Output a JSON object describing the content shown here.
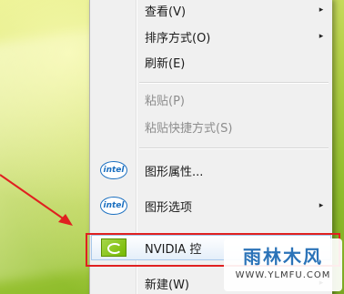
{
  "context_menu": {
    "items": [
      {
        "label": "查看(V)",
        "has_submenu": true,
        "enabled": true
      },
      {
        "label": "排序方式(O)",
        "has_submenu": true,
        "enabled": true
      },
      {
        "label": "刷新(E)",
        "has_submenu": false,
        "enabled": true
      },
      {
        "label": "粘贴(P)",
        "has_submenu": false,
        "enabled": false
      },
      {
        "label": "粘贴快捷方式(S)",
        "has_submenu": false,
        "enabled": false
      },
      {
        "label": "图形属性...",
        "has_submenu": false,
        "enabled": true,
        "icon": "intel-icon",
        "icon_text": "intel"
      },
      {
        "label": "图形选项",
        "has_submenu": true,
        "enabled": true,
        "icon": "intel-icon",
        "icon_text": "intel"
      },
      {
        "label": "NVIDIA 控",
        "has_submenu": false,
        "enabled": true,
        "icon": "nvidia-icon",
        "highlighted": true
      },
      {
        "label": "新建(W)",
        "has_submenu": true,
        "enabled": true
      }
    ],
    "submenu_glyph": "▸"
  },
  "watermark": {
    "title": "雨林木风",
    "url": "WWW.YLMFU.COM"
  },
  "colors": {
    "annotation_red": "#e02020",
    "menu_background": "#f0f0f0",
    "intel_blue": "#1a6fc0",
    "nvidia_green": "#76b900"
  }
}
